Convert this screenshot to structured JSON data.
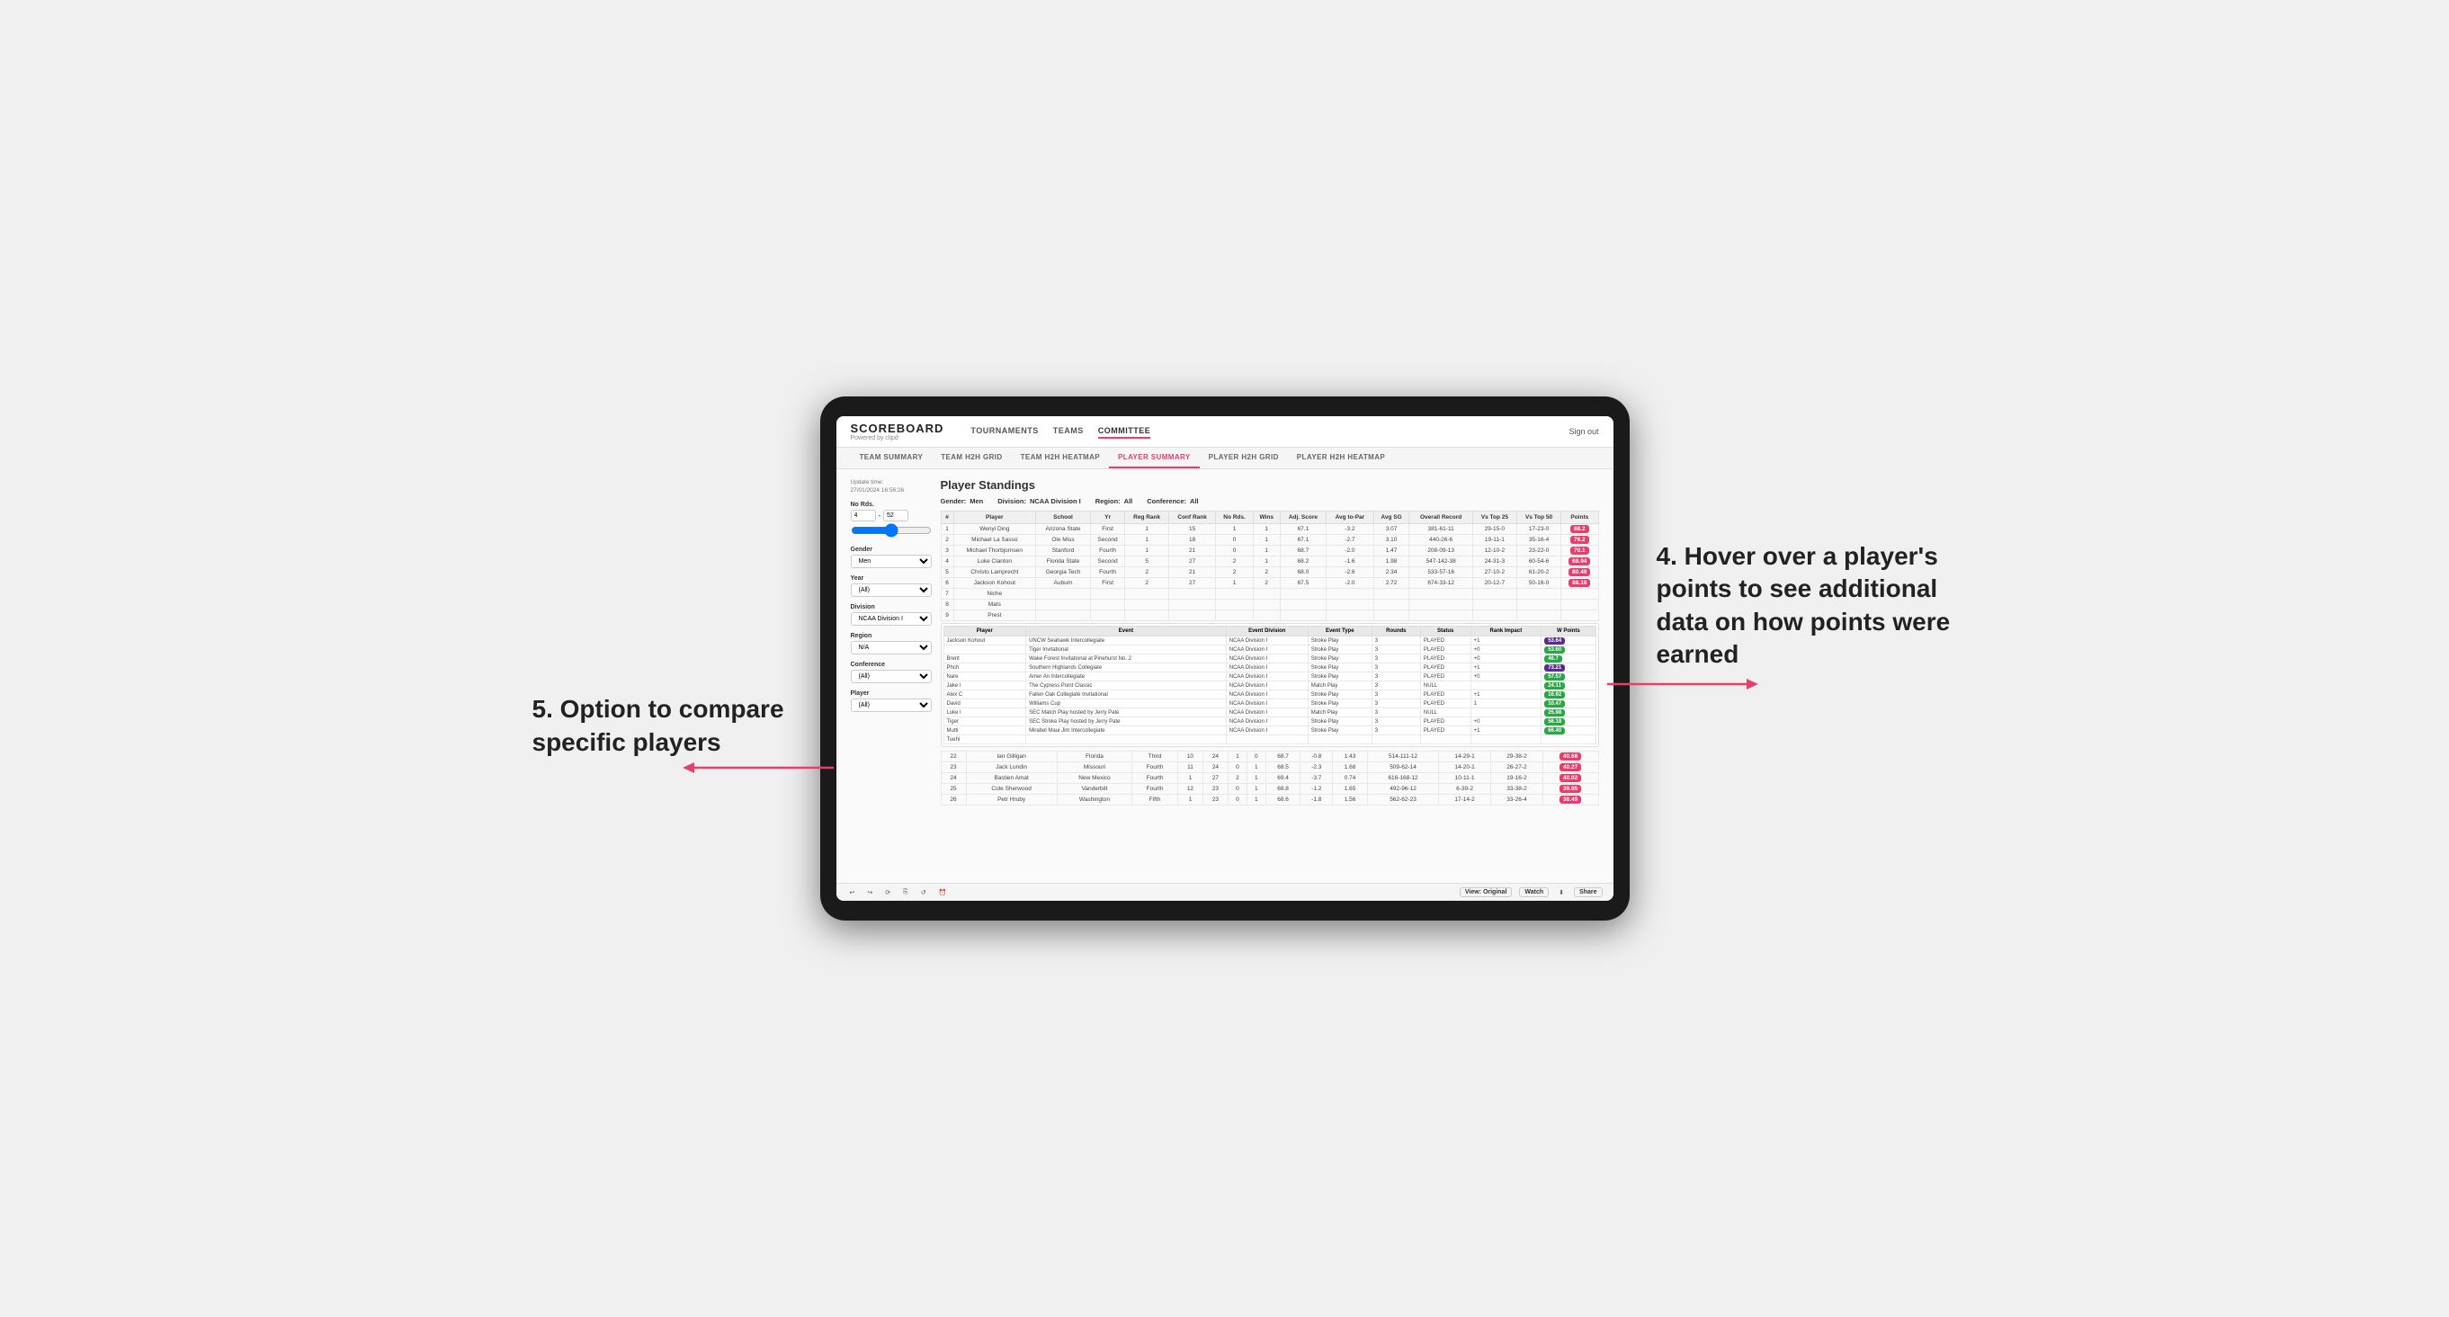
{
  "logo": {
    "title": "SCOREBOARD",
    "sub": "Powered by clipd"
  },
  "navbar": {
    "links": [
      "TOURNAMENTS",
      "TEAMS",
      "COMMITTEE"
    ],
    "active_link": "COMMITTEE",
    "sign_out": "Sign out"
  },
  "subnav": {
    "items": [
      "TEAM SUMMARY",
      "TEAM H2H GRID",
      "TEAM H2H HEATMAP",
      "PLAYER SUMMARY",
      "PLAYER H2H GRID",
      "PLAYER H2H HEATMAP"
    ],
    "active_item": "PLAYER SUMMARY"
  },
  "sidebar": {
    "update_label": "Update time:",
    "update_time": "27/01/2024 16:56:26",
    "no_rds_label": "No Rds.",
    "rds_min": "4",
    "rds_max": "52",
    "gender_label": "Gender",
    "gender_value": "Men",
    "year_label": "Year",
    "year_value": "(All)",
    "division_label": "Division",
    "division_value": "NCAA Division I",
    "region_label": "Region",
    "region_value": "N/A",
    "conference_label": "Conference",
    "conference_value": "(All)",
    "player_label": "Player",
    "player_value": "(All)"
  },
  "main": {
    "title": "Player Standings",
    "filters": {
      "gender_label": "Gender:",
      "gender_value": "Men",
      "division_label": "Division:",
      "division_value": "NCAA Division I",
      "region_label": "Region:",
      "region_value": "All",
      "conference_label": "Conference:",
      "conference_value": "All"
    },
    "table_headers": [
      "#",
      "Player",
      "School",
      "Yr",
      "Reg Rank",
      "Conf Rank",
      "No Rds.",
      "Wins",
      "Adj. Score",
      "Avg to-Par",
      "Avg SG",
      "Overall Record",
      "Vs Top 25",
      "Vs Top 50",
      "Points"
    ],
    "players": [
      {
        "rank": "1",
        "name": "Wenyi Ding",
        "school": "Arizona State",
        "yr": "First",
        "reg_rank": "1",
        "conf_rank": "15",
        "no_rds": "1",
        "wins": "1",
        "adj_score": "67.1",
        "to_par": "-3.2",
        "avg_sg": "3.07",
        "overall": "381-61-11",
        "vs25": "29-15-0",
        "vs50": "17-23-0",
        "points": "88.2",
        "highlight": true
      },
      {
        "rank": "2",
        "name": "Michael La Sasso",
        "school": "Ole Miss",
        "yr": "Second",
        "reg_rank": "1",
        "conf_rank": "18",
        "no_rds": "0",
        "wins": "1",
        "adj_score": "67.1",
        "to_par": "-2.7",
        "avg_sg": "3.10",
        "overall": "440-26-6",
        "vs25": "19-11-1",
        "vs50": "35-16-4",
        "points": "76.2",
        "highlight": false
      },
      {
        "rank": "3",
        "name": "Michael Thorbjornsen",
        "school": "Stanford",
        "yr": "Fourth",
        "reg_rank": "1",
        "conf_rank": "21",
        "no_rds": "0",
        "wins": "1",
        "adj_score": "68.7",
        "to_par": "-2.0",
        "avg_sg": "1.47",
        "overall": "208-09-13",
        "vs25": "12-10-2",
        "vs50": "23-22-0",
        "points": "70.1",
        "highlight": false
      },
      {
        "rank": "4",
        "name": "Luke Clanton",
        "school": "Florida State",
        "yr": "Second",
        "reg_rank": "5",
        "conf_rank": "27",
        "no_rds": "2",
        "wins": "1",
        "adj_score": "68.2",
        "to_par": "-1.6",
        "avg_sg": "1.98",
        "overall": "547-142-38",
        "vs25": "24-31-3",
        "vs50": "60-54-6",
        "points": "68.94",
        "highlight": false
      },
      {
        "rank": "5",
        "name": "Christo Lamprecht",
        "school": "Georgia Tech",
        "yr": "Fourth",
        "reg_rank": "2",
        "conf_rank": "21",
        "no_rds": "2",
        "wins": "2",
        "adj_score": "68.0",
        "to_par": "-2.6",
        "avg_sg": "2.34",
        "overall": "533-57-16",
        "vs25": "27-10-2",
        "vs50": "61-20-2",
        "points": "80.49",
        "highlight": false
      },
      {
        "rank": "6",
        "name": "Jackson Kohout",
        "school": "Auburn",
        "yr": "First",
        "reg_rank": "2",
        "conf_rank": "27",
        "no_rds": "1",
        "wins": "2",
        "adj_score": "67.5",
        "to_par": "-2.0",
        "avg_sg": "2.72",
        "overall": "674-33-12",
        "vs25": "20-12-7",
        "vs50": "50-16-0",
        "points": "88.18",
        "highlight": false
      },
      {
        "rank": "7",
        "name": "Niche",
        "school": "",
        "yr": "",
        "reg_rank": "",
        "conf_rank": "",
        "no_rds": "",
        "wins": "",
        "adj_score": "",
        "to_par": "",
        "avg_sg": "",
        "overall": "",
        "vs25": "",
        "vs50": "",
        "points": "",
        "highlight": false
      },
      {
        "rank": "8",
        "name": "Mats",
        "school": "",
        "yr": "",
        "reg_rank": "",
        "conf_rank": "",
        "no_rds": "",
        "wins": "",
        "adj_score": "",
        "to_par": "",
        "avg_sg": "",
        "overall": "",
        "vs25": "",
        "vs50": "",
        "points": "",
        "highlight": false
      },
      {
        "rank": "9",
        "name": "Prest",
        "school": "",
        "yr": "",
        "reg_rank": "",
        "conf_rank": "",
        "no_rds": "",
        "wins": "",
        "adj_score": "",
        "to_par": "",
        "avg_sg": "",
        "overall": "",
        "vs25": "",
        "vs50": "",
        "points": "",
        "highlight": false
      }
    ],
    "event_table_headers": [
      "Player",
      "Event",
      "Event Division",
      "Event Type",
      "Rounds",
      "Status",
      "Rank Impact",
      "W Points"
    ],
    "events": [
      {
        "player": "Jackson Kohout",
        "event": "UNCW Seahawk Intercollegiate",
        "division": "NCAA Division I",
        "type": "Stroke Play",
        "rounds": "3",
        "status": "PLAYED",
        "rank_impact": "+1",
        "points": "53.64",
        "highlight": true
      },
      {
        "player": "",
        "event": "Tiger Invitational",
        "division": "NCAA Division I",
        "type": "Stroke Play",
        "rounds": "3",
        "status": "PLAYED",
        "rank_impact": "+0",
        "points": "53.60",
        "highlight": false
      },
      {
        "player": "Brent",
        "event": "Wake Forest Invitational at Pinehurst No. 2",
        "division": "NCAA Division I",
        "type": "Stroke Play",
        "rounds": "3",
        "status": "PLAYED",
        "rank_impact": "+0",
        "points": "46.7",
        "highlight": false
      },
      {
        "player": "Phch",
        "event": "Southern Highlands Collegiate",
        "division": "NCAA Division I",
        "type": "Stroke Play",
        "rounds": "3",
        "status": "PLAYED",
        "rank_impact": "+1",
        "points": "73.21",
        "highlight": true
      },
      {
        "player": "Nare",
        "event": "Amer An Intercollegiate",
        "division": "NCAA Division I",
        "type": "Stroke Play",
        "rounds": "3",
        "status": "PLAYED",
        "rank_impact": "+0",
        "points": "57.57",
        "highlight": false
      },
      {
        "player": "Jake l",
        "event": "The Cypress Point Classic",
        "division": "NCAA Division I",
        "type": "Match Play",
        "rounds": "3",
        "status": "NULL",
        "rank_impact": "",
        "points": "24.11",
        "highlight": false
      },
      {
        "player": "Alex C",
        "event": "Fallen Oak Collegiate Invitational",
        "division": "NCAA Division I",
        "type": "Stroke Play",
        "rounds": "3",
        "status": "PLAYED",
        "rank_impact": "+1",
        "points": "16.92",
        "highlight": false
      },
      {
        "player": "David",
        "event": "Williams Cup",
        "division": "NCAA Division I",
        "type": "Stroke Play",
        "rounds": "3",
        "status": "PLAYED",
        "rank_impact": "1",
        "points": "10.47",
        "highlight": false
      },
      {
        "player": "Luke l",
        "event": "SEC Match Play hosted by Jerry Pate",
        "division": "NCAA Division I",
        "type": "Match Play",
        "rounds": "3",
        "status": "NULL",
        "rank_impact": "",
        "points": "25.98",
        "highlight": false
      },
      {
        "player": "Tiger",
        "event": "SEC Stroke Play hosted by Jerry Pate",
        "division": "NCAA Division I",
        "type": "Stroke Play",
        "rounds": "3",
        "status": "PLAYED",
        "rank_impact": "+0",
        "points": "56.18",
        "highlight": false
      },
      {
        "player": "Mutti",
        "event": "Mirabel Maui Jim Intercollegiate",
        "division": "NCAA Division I",
        "type": "Stroke Play",
        "rounds": "3",
        "status": "PLAYED",
        "rank_impact": "+1",
        "points": "66.40",
        "highlight": false
      },
      {
        "player": "Tuehi",
        "event": "",
        "division": "",
        "type": "",
        "rounds": "",
        "status": "",
        "rank_impact": "",
        "points": "",
        "highlight": false
      }
    ],
    "lower_players": [
      {
        "rank": "22",
        "name": "Ian Gilligan",
        "school": "Florida",
        "yr": "Third",
        "reg_rank": "10",
        "conf_rank": "24",
        "no_rds": "1",
        "wins": "0",
        "adj_score": "68.7",
        "to_par": "-0.8",
        "avg_sg": "1.43",
        "overall": "514-111-12",
        "vs25": "14-29-1",
        "vs50": "29-38-2",
        "points": "40.68",
        "highlight": false
      },
      {
        "rank": "23",
        "name": "Jack Lundin",
        "school": "Missouri",
        "yr": "Fourth",
        "reg_rank": "11",
        "conf_rank": "24",
        "no_rds": "0",
        "wins": "1",
        "adj_score": "68.5",
        "to_par": "-2.3",
        "avg_sg": "1.68",
        "overall": "509-62-14",
        "vs25": "14-20-1",
        "vs50": "26-27-2",
        "points": "40.27",
        "highlight": false
      },
      {
        "rank": "24",
        "name": "Bastien Amat",
        "school": "New Mexico",
        "yr": "Fourth",
        "reg_rank": "1",
        "conf_rank": "27",
        "no_rds": "2",
        "wins": "1",
        "adj_score": "69.4",
        "to_par": "-3.7",
        "avg_sg": "0.74",
        "overall": "616-168-12",
        "vs25": "10-11-1",
        "vs50": "19-16-2",
        "points": "40.02",
        "highlight": false
      },
      {
        "rank": "25",
        "name": "Cole Sherwood",
        "school": "Vanderbilt",
        "yr": "Fourth",
        "reg_rank": "12",
        "conf_rank": "23",
        "no_rds": "0",
        "wins": "1",
        "adj_score": "68.8",
        "to_par": "-1.2",
        "avg_sg": "1.65",
        "overall": "492-96-12",
        "vs25": "6-39-2",
        "vs50": "33-38-2",
        "points": "39.95",
        "highlight": false
      },
      {
        "rank": "26",
        "name": "Petr Hruby",
        "school": "Washington",
        "yr": "Fifth",
        "reg_rank": "1",
        "conf_rank": "23",
        "no_rds": "0",
        "wins": "1",
        "adj_score": "68.6",
        "to_par": "-1.8",
        "avg_sg": "1.56",
        "overall": "562-62-23",
        "vs25": "17-14-2",
        "vs50": "33-26-4",
        "points": "38.49",
        "highlight": false
      }
    ]
  },
  "footer": {
    "undo": "↩",
    "redo": "↪",
    "refresh": "⟳",
    "copy": "⎘",
    "reset": "↺",
    "clock": "⏰",
    "view_label": "View: Original",
    "watch_label": "Watch",
    "download": "⬇",
    "share_label": "Share"
  },
  "annotations": {
    "top_right": "4. Hover over a player's points to see additional data on how points were earned",
    "bottom_left": "5. Option to compare specific players"
  }
}
